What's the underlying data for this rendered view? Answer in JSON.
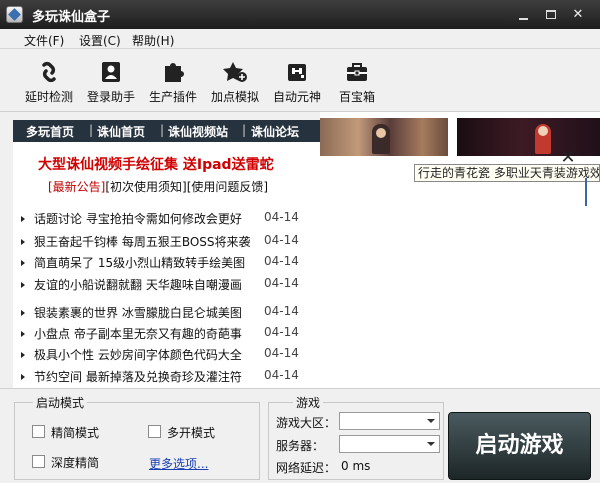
{
  "window": {
    "title": "多玩诛仙盒子"
  },
  "menu": [
    "文件(F)",
    "设置(C)",
    "帮助(H)"
  ],
  "toolbar": [
    {
      "label": "延时检测",
      "icon": "link-icon"
    },
    {
      "label": "登录助手",
      "icon": "user-card-icon"
    },
    {
      "label": "生产插件",
      "icon": "puzzle-icon"
    },
    {
      "label": "加点模拟",
      "icon": "star-plus-icon"
    },
    {
      "label": "自动元神",
      "icon": "robot-icon"
    },
    {
      "label": "百宝箱",
      "icon": "toolbox-icon"
    }
  ],
  "nav": [
    "多玩首页",
    "诛仙首页",
    "诛仙视频站",
    "诛仙论坛"
  ],
  "news": {
    "headline": "大型诛仙视频手绘征集 送Ipad送雷蛇",
    "sublinks": [
      "[最新公告]",
      "[初次使用须知]",
      "[使用问题反馈]"
    ],
    "items": [
      {
        "text": "话题讨论 寻宝抢拍令需如何修改会更好",
        "date": "04-14"
      },
      {
        "text": "狠王奋起千钧棒 每周五狠王BOSS将来袭",
        "date": "04-14"
      },
      {
        "text": "简直萌呆了 15级小烈山精致转手绘美图",
        "date": "04-14"
      },
      {
        "text": "友谊的小船说翻就翻 天华趣味自嘲漫画",
        "date": "04-14"
      },
      {
        "text": "银装素裹的世界 冰雪朦胧白昆仑城美图",
        "date": "04-14"
      },
      {
        "text": "小盘点 帝子副本里无奈又有趣的奇葩事",
        "date": "04-14"
      },
      {
        "text": "极具小个性 云妙房间字体颜色代码大全",
        "date": "04-14"
      },
      {
        "text": "节约空间 最新掉落及兑换奇珍及灌注符",
        "date": "04-14"
      }
    ]
  },
  "popup": {
    "tooltip": "行走的青花瓷 多职业天青装游戏效果"
  },
  "launch": {
    "title": "启动模式",
    "options": [
      "精简模式",
      "多开模式",
      "深度精简"
    ],
    "more_link": "更多选项..."
  },
  "game": {
    "title": "游戏",
    "region_label": "游戏大区：",
    "server_label": "服务器：",
    "latency_label": "网络延迟：",
    "latency_value": "0 ms",
    "region_value": "",
    "server_value": ""
  },
  "start_button": "启动游戏",
  "colors": {
    "titlebar": "#2a2a2a",
    "nav_strip": "#26323d",
    "headline": "#d00000",
    "link": "#1a3fb5"
  }
}
